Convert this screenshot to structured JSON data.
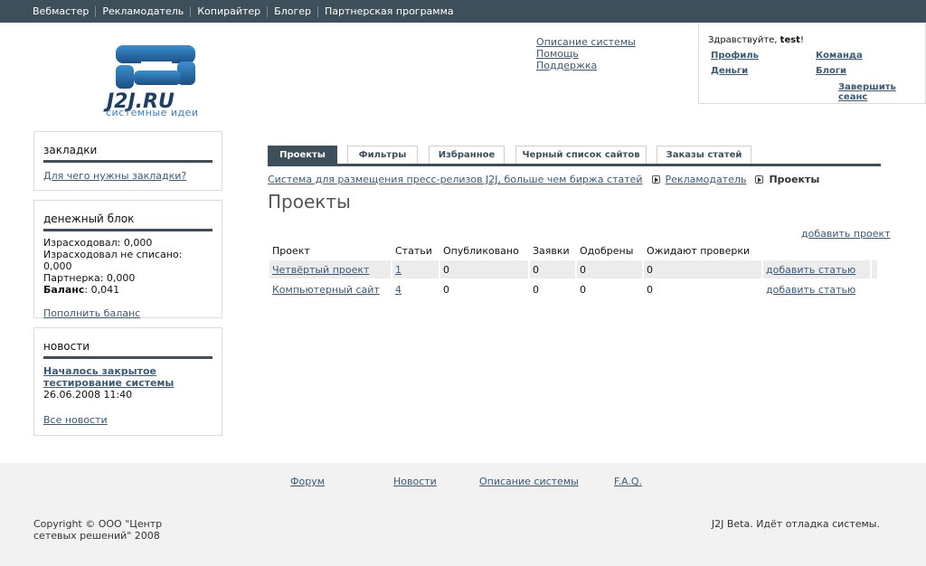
{
  "topnav": {
    "items": [
      "Вебмастер",
      "Рекламодатель",
      "Копирайтер",
      "Блогер",
      "Партнерская программа"
    ]
  },
  "logo": {
    "text": "J2J.RU",
    "subtitle": "системные идеи"
  },
  "infolinks": [
    "Описание системы",
    "Помощь",
    "Поддержка"
  ],
  "user": {
    "greeting": "Здравствуйте,",
    "name": "test",
    "excl": "!",
    "profile": "Профиль",
    "team": "Команда",
    "money": "Деньги",
    "blogs": "Блоги",
    "logout": "Завершить сеанс"
  },
  "sidebar": {
    "bookmarks": {
      "title": "закладки",
      "link": "Для чего нужны закладки?"
    },
    "money": {
      "title": "денежный блок",
      "spent": "Израсходовал: 0,000",
      "spent_pending": "Израсходовал не списано: 0,000",
      "partner": "Партнерка: 0,000",
      "balance_label": "Баланс",
      "balance_value": ": 0,041",
      "topup": "Пополнить баланс"
    },
    "news": {
      "title": "новости",
      "item_title": "Началось закрытое тестирование системы",
      "item_date": "26.06.2008 11:40",
      "all": "Все новости"
    }
  },
  "tabs": [
    "Проекты",
    "Фильтры",
    "Избранное",
    "Черный список сайтов",
    "Заказы статей"
  ],
  "breadcrumb": {
    "root": "Система для размещения пресс-релизов J2J, больше чем биржа статей",
    "mid": "Рекламодатель",
    "current": "Проекты"
  },
  "page_title": "Проекты",
  "add_project": "добавить проект",
  "table": {
    "headers": [
      "Проект",
      "Статьи",
      "Опубликовано",
      "Заявки",
      "Одобрены",
      "Ожидают проверки",
      ""
    ],
    "rows": [
      {
        "project": "Четвёртый проект",
        "articles": "1",
        "published": "0",
        "requests": "0",
        "approved": "0",
        "pending": "0",
        "action": "добавить статью"
      },
      {
        "project": "Компьютерный сайт",
        "articles": "4",
        "published": "0",
        "requests": "0",
        "approved": "0",
        "pending": "0",
        "action": "добавить статью"
      }
    ]
  },
  "footer": {
    "links": [
      "Форум",
      "Новости",
      "Описание системы",
      "F.A.Q."
    ],
    "copyright": "Copyright © ООО \"Центр сетевых решений\" 2008",
    "beta": "J2J Beta. Идёт отладка системы."
  }
}
